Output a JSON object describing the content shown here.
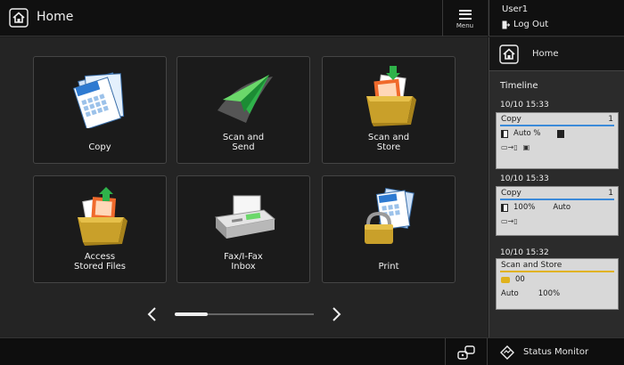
{
  "header": {
    "title": "Home",
    "menu_label": "Menu"
  },
  "user": {
    "name": "User1",
    "logout_label": "Log Out"
  },
  "tiles": [
    {
      "label": "Copy"
    },
    {
      "label": "Scan and\nSend"
    },
    {
      "label": "Scan and\nStore"
    },
    {
      "label": "Access\nStored Files"
    },
    {
      "label": "Fax/I-Fax\nInbox"
    },
    {
      "label": "Print"
    }
  ],
  "pager": {
    "progress_fraction": 0.24
  },
  "sidebar": {
    "home_label": "Home",
    "timeline_title": "Timeline",
    "entries": [
      {
        "time": "10/10 15:33",
        "job": "Copy",
        "count": "1",
        "detail1": "Auto %",
        "accent": "#3b8ad9"
      },
      {
        "time": "10/10 15:33",
        "job": "Copy",
        "count": "1",
        "detail1": "100%",
        "detail2": "Auto",
        "accent": "#3b8ad9"
      },
      {
        "time": "10/10 15:32",
        "job": "Scan and Store",
        "count": "",
        "detail1": "00",
        "detail2": "Auto",
        "detail3": "100%",
        "accent": "#e0b21c"
      }
    ]
  },
  "footer": {
    "status_label": "Status Monitor"
  }
}
